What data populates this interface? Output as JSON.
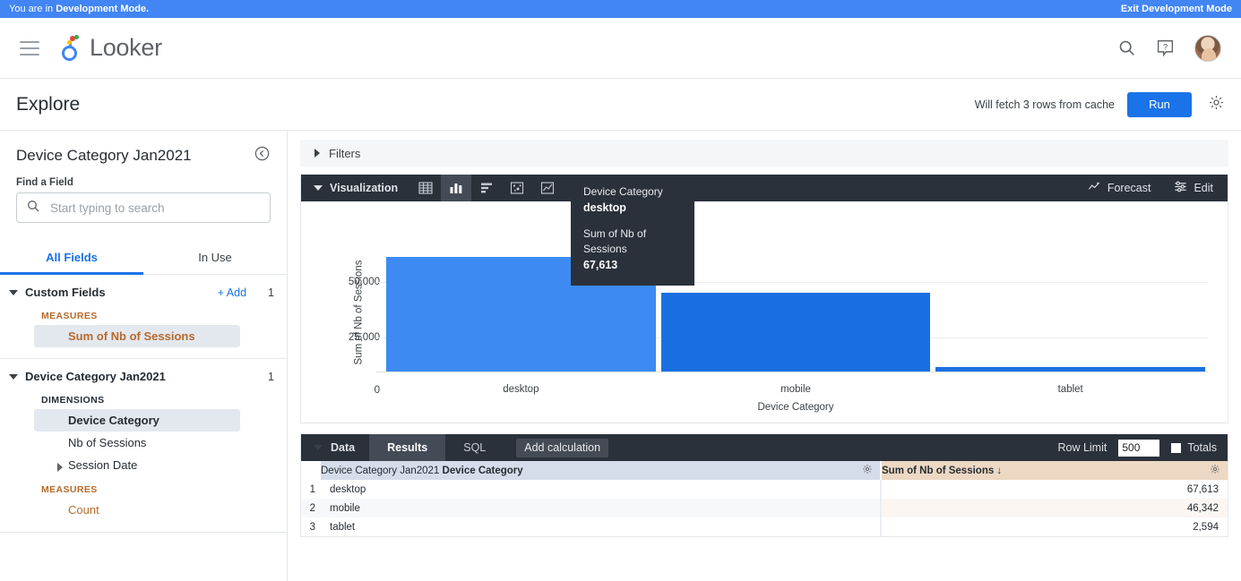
{
  "dev_banner": {
    "message_prefix": "You are in ",
    "message_bold": "Development Mode.",
    "exit_label": "Exit Development Mode"
  },
  "topnav": {
    "brand": "Looker",
    "menu_icon": "hamburger-icon",
    "search_icon": "search-icon",
    "help_icon": "help-icon",
    "avatar": "user-avatar"
  },
  "explore_header": {
    "title": "Explore",
    "fetch_note": "Will fetch 3 rows from cache",
    "run_label": "Run",
    "settings_icon": "gear-icon"
  },
  "sidebar": {
    "title": "Device Category Jan2021",
    "collapse_icon": "collapse-left-icon",
    "find_label": "Find a Field",
    "search_placeholder": "Start typing to search",
    "search_value": "",
    "tabs": [
      {
        "label": "All Fields",
        "active": true
      },
      {
        "label": "In Use",
        "active": false
      }
    ],
    "groups": [
      {
        "name": "Custom Fields",
        "add_label": "+ Add",
        "count": "1",
        "sections": [
          {
            "heading": "MEASURES",
            "kind": "measure",
            "fields": [
              {
                "label": "Sum of Nb of Sessions",
                "selected": true
              }
            ]
          }
        ]
      },
      {
        "name": "Device Category Jan2021",
        "count": "1",
        "sections": [
          {
            "heading": "DIMENSIONS",
            "kind": "dimension",
            "fields": [
              {
                "label": "Device Category",
                "selected": true
              },
              {
                "label": "Nb of Sessions",
                "selected": false
              },
              {
                "label": "Session Date",
                "selected": false,
                "expandable": true
              }
            ]
          },
          {
            "heading": "MEASURES",
            "kind": "measure",
            "fields": [
              {
                "label": "Count",
                "selected": false
              }
            ]
          }
        ]
      }
    ]
  },
  "filters": {
    "label": "Filters"
  },
  "visualization": {
    "label": "Visualization",
    "icons": [
      {
        "name": "table-viz-icon",
        "active": false
      },
      {
        "name": "column-chart-icon",
        "active": true
      },
      {
        "name": "bar-chart-icon",
        "active": false
      },
      {
        "name": "scatter-plot-icon",
        "active": false
      },
      {
        "name": "line-chart-icon",
        "active": false
      },
      {
        "name": "area-chart-icon",
        "active": false
      },
      {
        "name": "pie-chart-icon",
        "active": false
      }
    ],
    "more_icon": "more-options-icon",
    "forecast_label": "Forecast",
    "forecast_icon": "forecast-icon",
    "edit_label": "Edit",
    "edit_icon": "edit-settings-icon"
  },
  "tooltip": {
    "dimension_label": "Device Category",
    "dimension_value": "desktop",
    "measure_label": "Sum of Nb of Sessions",
    "measure_value": "67,613"
  },
  "chart_data": {
    "type": "bar",
    "categories": [
      "desktop",
      "mobile",
      "tablet"
    ],
    "values": [
      67613,
      46342,
      2594
    ],
    "title": "",
    "xlabel": "Device Category",
    "ylabel": "Sum of Nb of Sessions",
    "ylim": [
      0,
      75000
    ],
    "yticks": [
      0,
      25000,
      50000
    ],
    "ytick_labels": [
      "0",
      "25,000",
      "50,000"
    ],
    "grid": true,
    "legend": false,
    "colors": [
      "#3d8bf2",
      "#1a6fe0",
      "#1a6fe0"
    ],
    "hovered_category": "desktop"
  },
  "data_panel": {
    "label": "Data",
    "tabs": [
      {
        "label": "Results",
        "active": true
      },
      {
        "label": "SQL",
        "active": false
      }
    ],
    "add_calculation_label": "Add calculation",
    "row_limit_label": "Row Limit",
    "row_limit_value": "500",
    "totals_label": "Totals",
    "totals_checked": false,
    "table": {
      "columns": [
        {
          "explore": "Device Category Jan2021",
          "field": "Device Category",
          "type": "dimension",
          "gear_icon": "column-gear-icon"
        },
        {
          "explore": "",
          "field": "Sum of Nb of Sessions ↓",
          "type": "measure",
          "gear_icon": "column-gear-icon"
        }
      ],
      "rows": [
        {
          "index": "1",
          "dimension": "desktop",
          "measure": "67,613"
        },
        {
          "index": "2",
          "dimension": "mobile",
          "measure": "46,342"
        },
        {
          "index": "3",
          "dimension": "tablet",
          "measure": "2,594"
        }
      ]
    }
  },
  "colors": {
    "accent": "#1a73e8",
    "banner": "#4285f4",
    "bar": "#1a6fe0",
    "bar_hover": "#3d8bf2",
    "dark_panel": "#2b313b",
    "dimension_header": "#d5dcea",
    "measure_header": "#edd8c4",
    "measure_text": "#b86a2b"
  }
}
